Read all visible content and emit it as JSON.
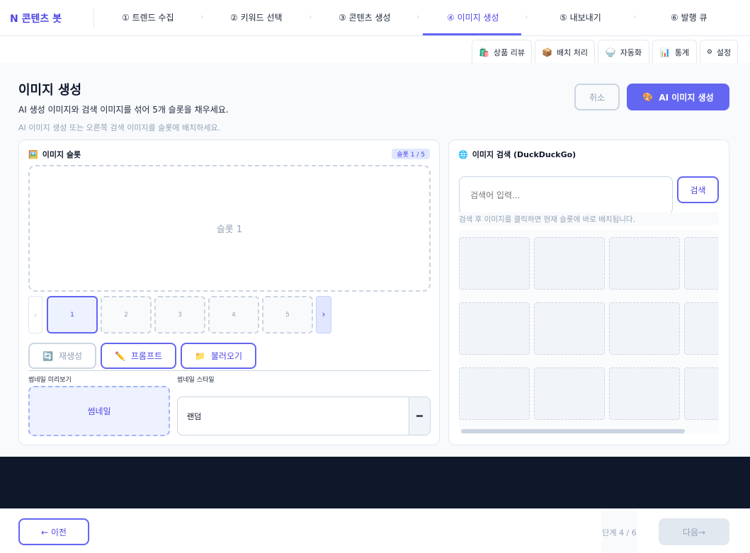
{
  "brand": "N 콘텐츠 봇",
  "steps": [
    {
      "label": "① 트렌드 수집"
    },
    {
      "label": "② 키워드 선택"
    },
    {
      "label": "③ 콘텐츠 생성"
    },
    {
      "label": "④ 이미지 생성",
      "active": true
    },
    {
      "label": "⑤ 내보내기"
    },
    {
      "label": "⑥ 발행 큐"
    }
  ],
  "tool_tabs": [
    {
      "icon": "🛍️",
      "icon_name": "shopping-bag-icon",
      "label": "상품 리뷰"
    },
    {
      "icon": "📦",
      "icon_name": "package-icon",
      "label": "배치 처리"
    },
    {
      "icon": "🍚",
      "icon_name": "bowl-icon",
      "label": "자동화"
    },
    {
      "icon": "📊",
      "icon_name": "bar-chart-icon",
      "label": "통계"
    },
    {
      "icon": "⚙",
      "icon_name": "gear-icon",
      "label": "설정"
    }
  ],
  "page": {
    "title": "이미지 생성",
    "subtitle": "AI 생성 이미지와 검색 이미지를 섞어 5개 슬롯을 채우세요.",
    "hint": "AI 이미지 생성 또는 오른쪽 검색 이미지를 슬롯에 배치하세요.",
    "cancel_label": "취소",
    "ai_icon": "🎨",
    "ai_label": "AI 이미지 생성"
  },
  "slots": {
    "header_icon": "🖼️",
    "header": "이미지 슬롯",
    "badge": "슬롯 1 / 5",
    "main_label": "슬롯 1",
    "prev_arrow": "‹",
    "next_arrow": "›",
    "thumbs": [
      "1",
      "2",
      "3",
      "4",
      "5"
    ],
    "active_index": 0
  },
  "actions": {
    "regen_icon": "🔄",
    "regen_label": "재생성",
    "prompt_icon": "✏️",
    "prompt_label": "프롬프트",
    "load_icon": "📁",
    "load_label": "불러오기"
  },
  "thumbnail": {
    "preview_label": "썸네일 미리보기",
    "preview_text": "썸네일",
    "style_label": "썸네일 스타일",
    "style_value": "랜덤"
  },
  "search": {
    "header_icon": "🌐",
    "header": "이미지 검색 (DuckDuckGo)",
    "placeholder": "검색어 입력...",
    "button_label": "검색",
    "hint": "검색 후 이미지를 클릭하면 현재 슬롯에 바로 배치됩니다.",
    "result_count": 12
  },
  "footer": {
    "prev_label": "← 이전",
    "step_indicator": "단계  4 / 6",
    "next_label": "다음→"
  },
  "colors": {
    "accent": "#6366f1",
    "accent_text": "#4f46e5",
    "footer_band": "#0f172a"
  }
}
